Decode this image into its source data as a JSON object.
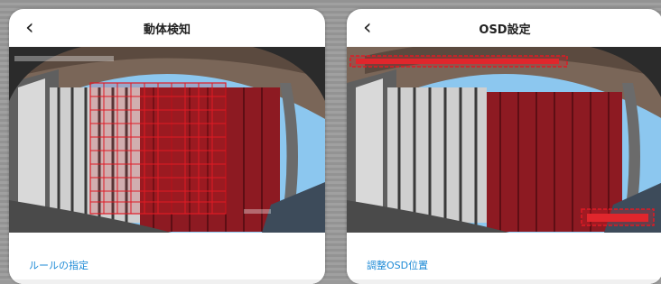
{
  "screens": [
    {
      "title": "動体検知",
      "back_icon": "chevron-left-icon",
      "menu_item": "ルールの指定"
    },
    {
      "title": "OSD設定",
      "back_icon": "chevron-left-icon",
      "menu_item": "調整OSD位置"
    }
  ],
  "colors": {
    "link_blue": "#1d8ad6",
    "overlay_red": "#c8141e",
    "sky_blue": "#8cc7ef"
  }
}
